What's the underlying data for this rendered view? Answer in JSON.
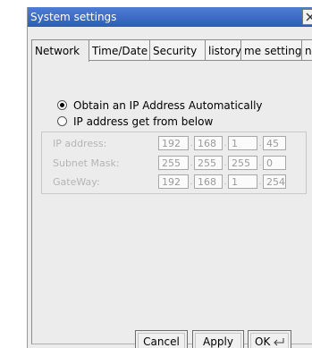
{
  "window": {
    "title": "System settings"
  },
  "tabs": [
    {
      "label": "Network",
      "active": true
    },
    {
      "label": "Time/Date",
      "active": false
    },
    {
      "label": "Security",
      "active": false
    },
    {
      "label": "listory",
      "active": false
    },
    {
      "label": "me setting",
      "active": false
    },
    {
      "label": "ng",
      "active": false
    }
  ],
  "network": {
    "option_auto": {
      "label": "Obtain an IP Address Automatically",
      "checked": true
    },
    "option_manual": {
      "label": "IP address get from below",
      "checked": false
    },
    "fields": [
      {
        "label": "IP address:",
        "octets": [
          "192",
          "168",
          "1",
          "45"
        ]
      },
      {
        "label": "Subnet Mask:",
        "octets": [
          "255",
          "255",
          "255",
          "0"
        ]
      },
      {
        "label": "GateWay:",
        "octets": [
          "192",
          "168",
          "1",
          "254"
        ]
      }
    ]
  },
  "buttons": {
    "cancel": "Cancel",
    "apply": "Apply",
    "ok": "OK"
  },
  "icons": {
    "close": "close-icon",
    "enter": "enter-icon"
  },
  "colors": {
    "titlebar": "#3a66c2",
    "title_text": "#ffffff",
    "disabled_text": "#b5b5b5"
  }
}
